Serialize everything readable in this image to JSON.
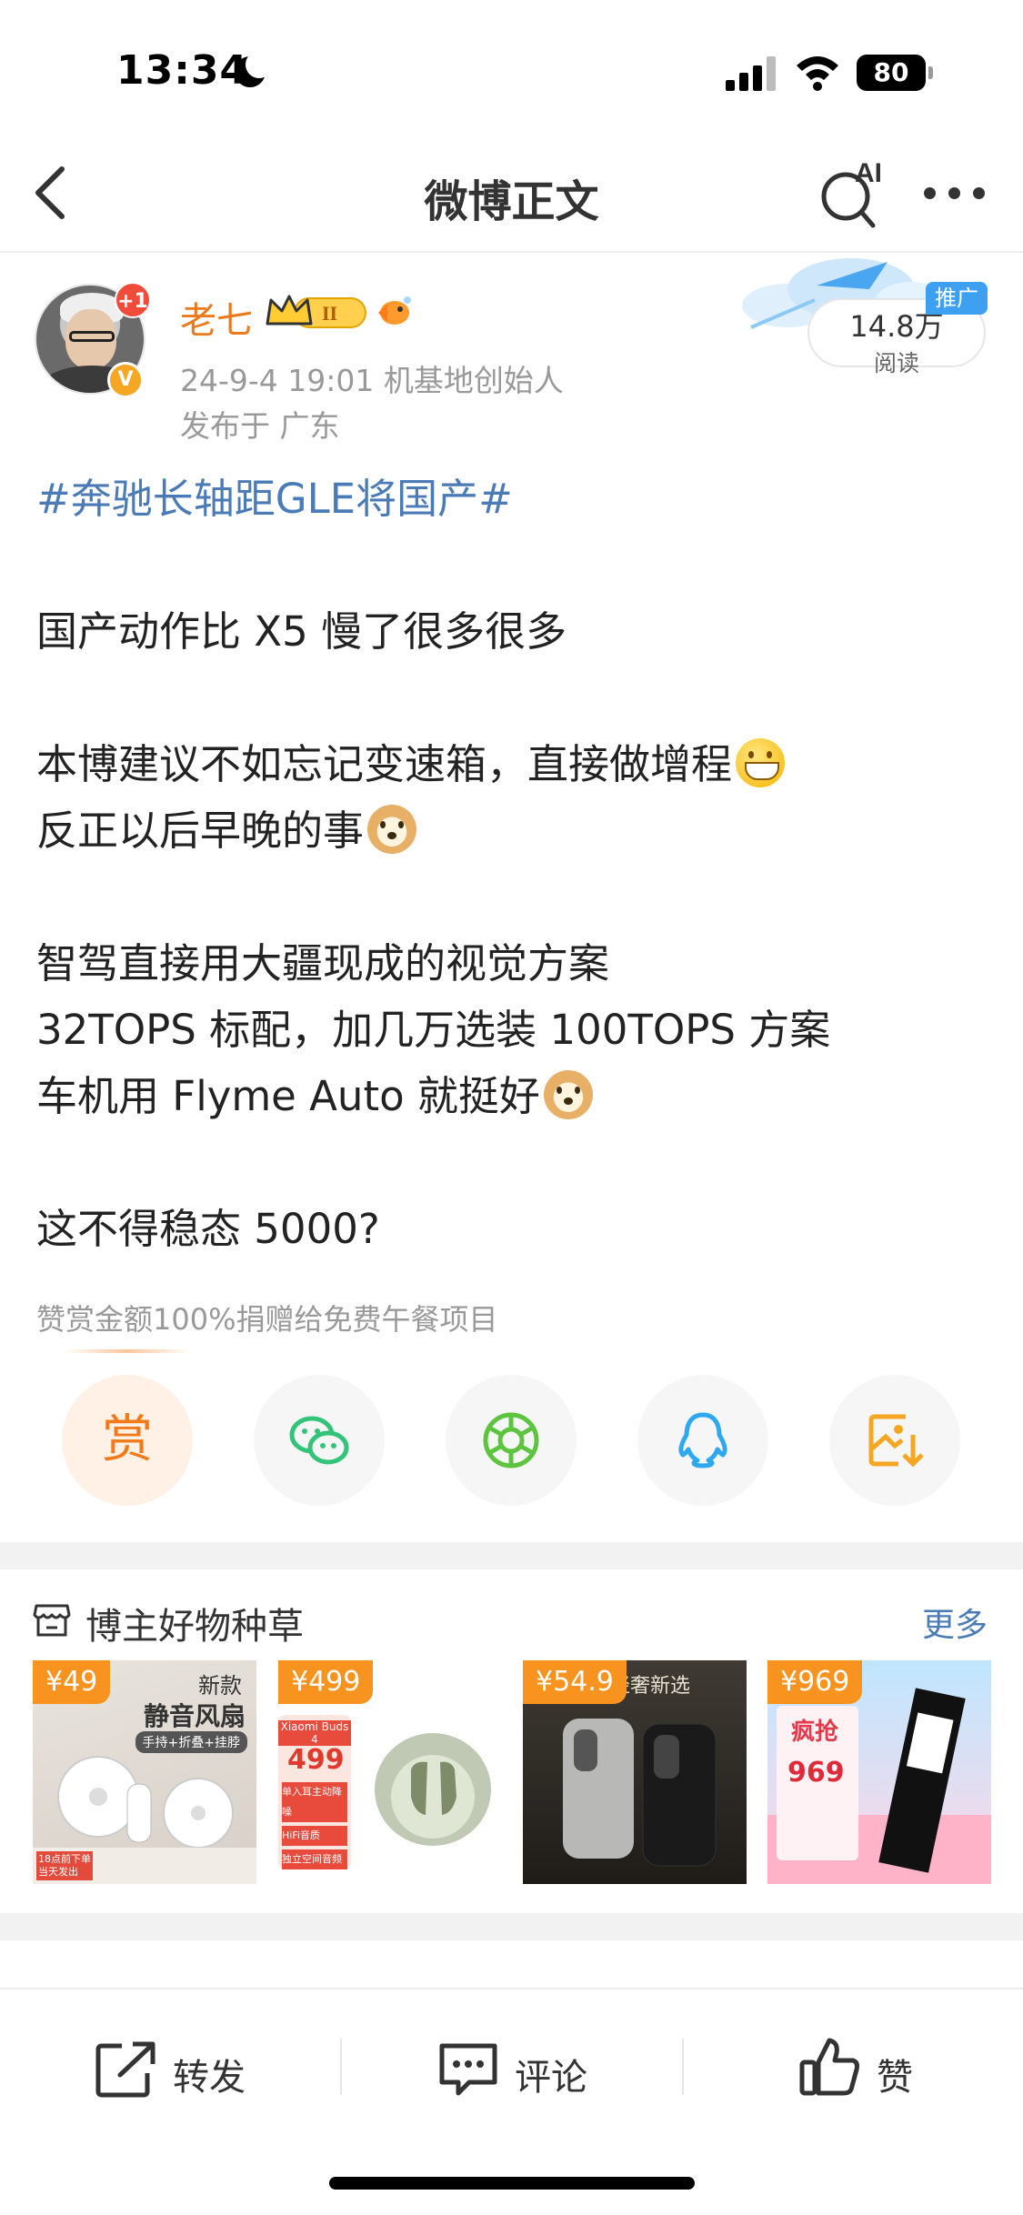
{
  "status_bar": {
    "time": "13:34",
    "battery": "80"
  },
  "nav": {
    "title": "微博正文",
    "ai_label": "AI"
  },
  "author": {
    "name": "老七",
    "notification_badge": "+1",
    "verified_mark": "V",
    "level": "II",
    "timestamp_and_title": "24-9-4 19:01  机基地创始人",
    "location": "发布于 广东"
  },
  "reads": {
    "count": "14.8万",
    "label": "阅读",
    "ad_tag": "推广"
  },
  "post": {
    "hashtag": "#奔驰长轴距GLE将国产#",
    "line1": "国产动作比 X5 慢了很多很多",
    "line2": "本博建议不如忘记变速箱，直接做增程",
    "line3": "反正以后早晚的事",
    "line4": "智驾直接用大疆现成的视觉方案",
    "line5": "32TOPS 标配，加几万选装 100TOPS 方案",
    "line6": "车机用 Flyme Auto 就挺好",
    "line7": "这不得稳态 5000?"
  },
  "donate_note": "赞赏金额100%捐赠给免费午餐项目",
  "share": {
    "reward_label": "赏",
    "targets": [
      "wechat-icon",
      "moments-icon",
      "qq-icon",
      "save-image-icon"
    ]
  },
  "goods": {
    "title": "博主好物种草",
    "more": "更多",
    "items": [
      {
        "price": "¥49",
        "headline": "新款",
        "subtitle": "静音风扇",
        "tag": "手持+折叠+挂脖",
        "ribbon": "18点前下单 当天发出"
      },
      {
        "price": "¥499",
        "brand": "Xiaomi Buds 4",
        "promo_price": "499",
        "tags": [
          "单入耳主动降噪",
          "HiFi音质",
          "独立空间音频"
        ]
      },
      {
        "price": "¥54.9",
        "headline": "轻奢新选"
      },
      {
        "price": "¥969",
        "headline": "疯抢",
        "promo_price": "969"
      }
    ]
  },
  "bottom_bar": {
    "repost": "转发",
    "comment": "评论",
    "like": "赞"
  },
  "colors": {
    "orange": "#ec7a1c",
    "link": "#4a7bb7",
    "price_tag": "#f7931e",
    "text": "#222222",
    "muted": "#999999"
  }
}
